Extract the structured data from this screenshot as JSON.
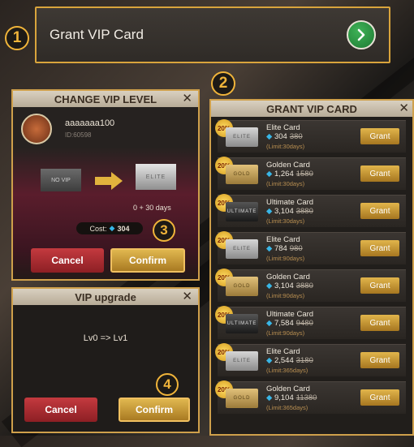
{
  "steps": [
    "1",
    "2",
    "3",
    "4"
  ],
  "top": {
    "title": "Grant VIP Card",
    "go_icon": "chevron-right-icon"
  },
  "change_vip": {
    "header": "CHANGE VIP LEVEL",
    "user_name": "aaaaaaa100",
    "user_id": "ID:60598",
    "from_card": "NO VIP",
    "to_card": "ELITE",
    "days": "0 + 30 days",
    "cost_label": "Cost:",
    "cost_value": "304",
    "cancel": "Cancel",
    "confirm": "Confirm"
  },
  "vip_upgrade": {
    "header": "VIP upgrade",
    "message": "Lv0 => Lv1",
    "cancel": "Cancel",
    "confirm": "Confirm"
  },
  "grant_vip": {
    "header": "GRANT VIP CARD",
    "discount": "20%",
    "grant_label": "Grant",
    "cards": [
      {
        "name": "Elite Card",
        "price": "304",
        "old": "380",
        "limit": "(Limit:30days)",
        "type": "elite",
        "thumb": "ELITE"
      },
      {
        "name": "Golden Card",
        "price": "1,264",
        "old": "1580",
        "limit": "(Limit:30days)",
        "type": "gold",
        "thumb": "GOLD"
      },
      {
        "name": "Ultimate Card",
        "price": "3,104",
        "old": "3880",
        "limit": "(Limit:30days)",
        "type": "ult",
        "thumb": "ULTIMATE"
      },
      {
        "name": "Elite Card",
        "price": "784",
        "old": "980",
        "limit": "(Limit:90days)",
        "type": "elite",
        "thumb": "ELITE"
      },
      {
        "name": "Golden Card",
        "price": "3,104",
        "old": "3880",
        "limit": "(Limit:90days)",
        "type": "gold",
        "thumb": "GOLD"
      },
      {
        "name": "Ultimate Card",
        "price": "7,584",
        "old": "9480",
        "limit": "(Limit:90days)",
        "type": "ult",
        "thumb": "ULTIMATE"
      },
      {
        "name": "Elite Card",
        "price": "2,544",
        "old": "3180",
        "limit": "(Limit:365days)",
        "type": "elite",
        "thumb": "ELITE"
      },
      {
        "name": "Golden Card",
        "price": "9,104",
        "old": "11380",
        "limit": "(Limit:365days)",
        "type": "gold",
        "thumb": "GOLD"
      }
    ]
  }
}
